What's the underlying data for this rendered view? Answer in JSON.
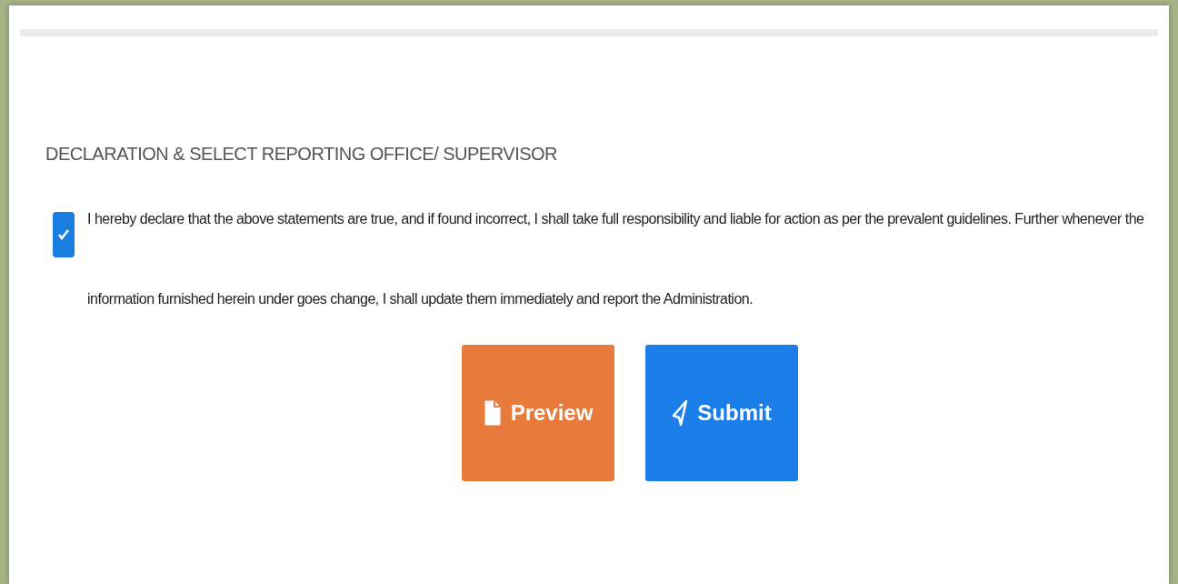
{
  "section_title": "DECLARATION & SELECT REPORTING OFFICE/ SUPERVISOR",
  "declaration": {
    "checked": true,
    "text": "I hereby declare that the above statements are true, and if found incorrect, I shall take full responsibility and liable for action as per the prevalent guidelines. Further whenever the information furnished herein under goes change, I shall update them immediately and report the Administration."
  },
  "buttons": [
    {
      "label": "Preview",
      "kind": "preview"
    },
    {
      "label": "Submit",
      "kind": "submit"
    }
  ]
}
